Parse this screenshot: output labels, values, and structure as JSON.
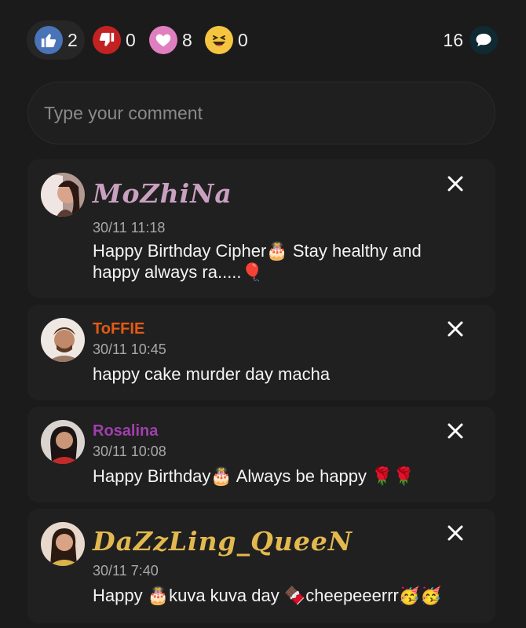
{
  "reactions": {
    "like": {
      "icon": "thumbs-up-icon",
      "count": "2",
      "color": "#4a74b8"
    },
    "dislike": {
      "icon": "thumbs-down-icon",
      "count": "0",
      "color": "#c32222"
    },
    "love": {
      "icon": "heart-icon",
      "count": "8",
      "color": "#e07fc0"
    },
    "haha": {
      "icon": "laughing-face-icon",
      "count": "0",
      "color": "#f5c542"
    },
    "comments": {
      "icon": "speech-bubble-icon",
      "count": "16"
    }
  },
  "comment_input": {
    "placeholder": "Type your comment"
  },
  "comments": [
    {
      "author": "MoZhiNa",
      "author_color": "#c9a0bf",
      "time": "30/11 11:18",
      "text": "Happy Birthday Cipher🎂 Stay healthy and happy always ra.....🎈"
    },
    {
      "author": "ToFFIE",
      "author_color": "#e35a16",
      "time": "30/11 10:45",
      "text": "happy cake murder day macha"
    },
    {
      "author": "Rosalina",
      "author_color": "#a03fae",
      "time": "30/11 10:08",
      "text": "Happy Birthday🎂 Always be happy 🌹🌹"
    },
    {
      "author": "DaZzLing_QueeN",
      "author_color": "#e3b94f",
      "time": "30/11 7:40",
      "text": "Happy 🎂kuva kuva day 🍫cheepeeerrr🥳🥳"
    }
  ]
}
